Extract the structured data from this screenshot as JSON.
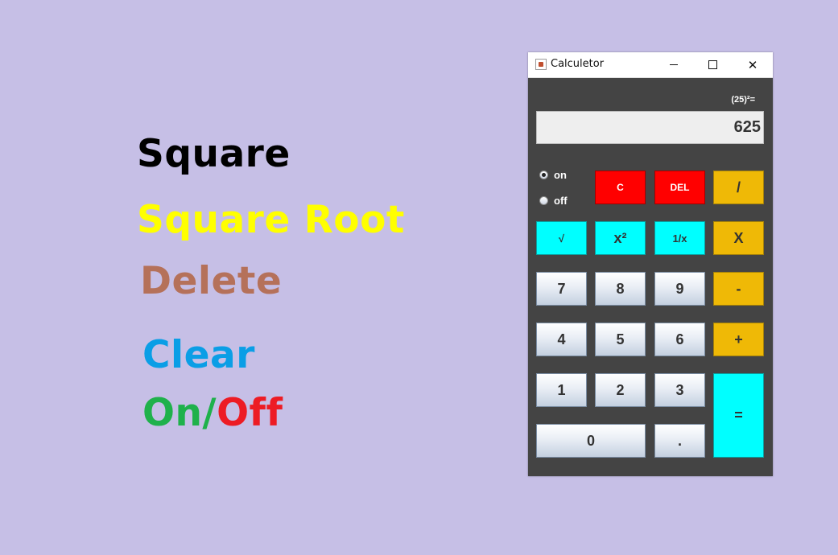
{
  "features": {
    "square": {
      "label": "Square",
      "color": "#000000"
    },
    "square_root": {
      "label": "Square Root",
      "color": "#ffff00"
    },
    "delete": {
      "label": "Delete",
      "color": "#b5715a"
    },
    "clear": {
      "label": "Clear",
      "color": "#0a9ee6"
    },
    "on_off": {
      "on": "On/",
      "off": "Off",
      "on_color": "#1fb14b",
      "off_color": "#ed1c24"
    }
  },
  "window": {
    "title": "Calculetor",
    "minimize": "minimize",
    "maximize": "maximize",
    "close": "✕"
  },
  "calculator": {
    "expression": "(25)²=",
    "display": "625",
    "radio_on": "on",
    "radio_off": "off",
    "selected_power": "on",
    "keys": {
      "clear": "C",
      "delete": "DEL",
      "divide": "/",
      "sqrt": "√",
      "square": "x²",
      "reciprocal": "1/x",
      "multiply": "X",
      "seven": "7",
      "eight": "8",
      "nine": "9",
      "minus": "-",
      "four": "4",
      "five": "5",
      "six": "6",
      "plus": "+",
      "one": "1",
      "two": "2",
      "three": "3",
      "equals": "=",
      "zero": "0",
      "dot": "."
    }
  },
  "colors": {
    "background": "#c6bfe6",
    "panel": "#444444",
    "red_key": "#ff0000",
    "gold_key": "#efb906",
    "cyan_key": "#00ffff"
  }
}
